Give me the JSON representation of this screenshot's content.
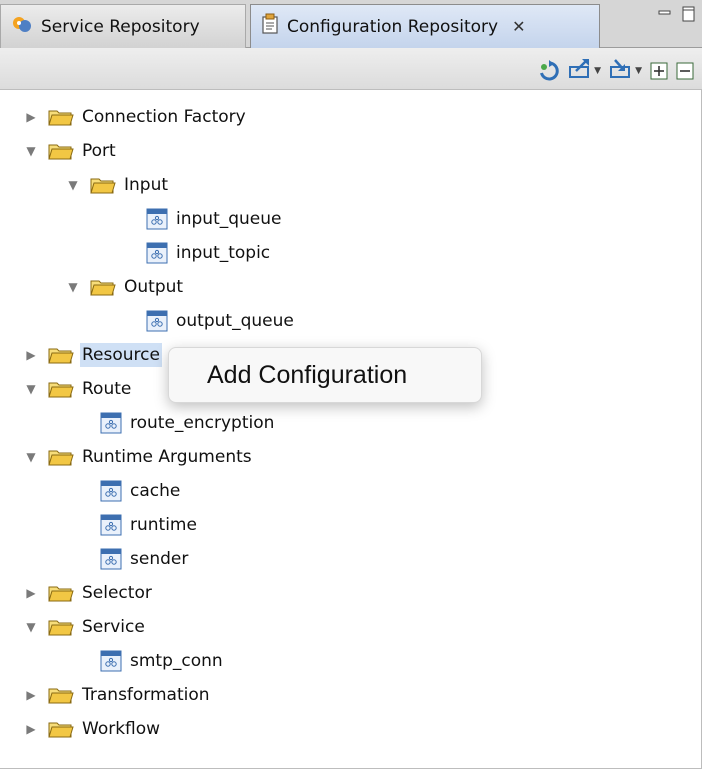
{
  "tabs": [
    {
      "label": "Service Repository",
      "icon": "service-repository-icon",
      "active": false
    },
    {
      "label": "Configuration Repository",
      "icon": "configuration-repository-icon",
      "active": true,
      "close_glyph": "✕"
    }
  ],
  "window_buttons": [
    "minimize-icon",
    "maximize-icon"
  ],
  "toolbar": {
    "buttons": [
      "refresh-icon",
      "export-icon",
      "import-icon",
      "expand-all-icon",
      "collapse-all-icon"
    ]
  },
  "tree": {
    "items": [
      {
        "label": "Connection Factory",
        "type": "folder",
        "expanded": false
      },
      {
        "label": "Port",
        "type": "folder",
        "expanded": true
      },
      {
        "label": "Input",
        "type": "folder",
        "expanded": true
      },
      {
        "label": "input_queue",
        "type": "config"
      },
      {
        "label": "input_topic",
        "type": "config"
      },
      {
        "label": "Output",
        "type": "folder",
        "expanded": true
      },
      {
        "label": "output_queue",
        "type": "config"
      },
      {
        "label": "Resource",
        "type": "folder",
        "expanded": false,
        "selected": true
      },
      {
        "label": "Route",
        "type": "folder",
        "expanded": true
      },
      {
        "label": "route_encryption",
        "type": "config"
      },
      {
        "label": "Runtime Arguments",
        "type": "folder",
        "expanded": true
      },
      {
        "label": "cache",
        "type": "config"
      },
      {
        "label": "runtime",
        "type": "config"
      },
      {
        "label": "sender",
        "type": "config"
      },
      {
        "label": "Selector",
        "type": "folder",
        "expanded": false
      },
      {
        "label": "Service",
        "type": "folder",
        "expanded": true
      },
      {
        "label": "smtp_conn",
        "type": "config"
      },
      {
        "label": "Transformation",
        "type": "folder",
        "expanded": false
      },
      {
        "label": "Workflow",
        "type": "folder",
        "expanded": false
      }
    ]
  },
  "context_menu": {
    "item": "Add Configuration"
  },
  "colors": {
    "selection": "#cfe0f5",
    "folder": "#f2c744",
    "config_icon": "#3d6fb0"
  }
}
